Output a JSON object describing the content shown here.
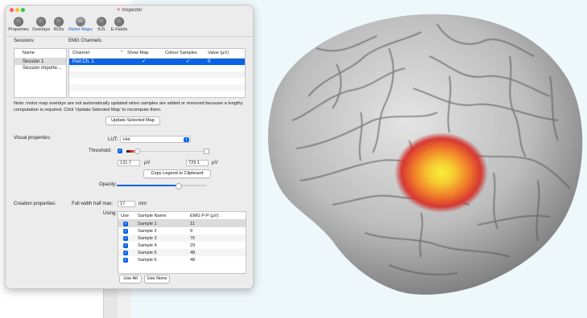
{
  "window": {
    "title": "Inspector"
  },
  "toolbar": {
    "items": [
      {
        "label": "Properties",
        "icon": "properties-icon"
      },
      {
        "label": "Overlays",
        "icon": "overlays-icon"
      },
      {
        "label": "ROIs",
        "icon": "rois-icon"
      },
      {
        "label": "Motor Maps",
        "icon": "motor-maps-icon"
      },
      {
        "label": "fUS",
        "icon": "fus-icon"
      },
      {
        "label": "E-Fields",
        "icon": "e-fields-icon"
      }
    ],
    "active": "Motor Maps"
  },
  "sessions": {
    "label": "Sessions:",
    "column": "Name",
    "items": [
      "Session 1",
      "Session importe..."
    ]
  },
  "emg": {
    "label": "EMG Channels:",
    "columns": [
      "Channel",
      "Show Map",
      "Colour Samples",
      "Value (µV)"
    ],
    "rows": [
      {
        "channel": "Pod Ch. 1",
        "show_map": true,
        "colour_samples": true,
        "value": "0"
      }
    ]
  },
  "note": "Note: motor map overlays are not automatically updated when samples are added or removed because a lengthy computation is required. Click 'Update Selected Map' to recompute them.",
  "update_button": "Update Selected Map",
  "visual": {
    "label": "Visual properties:",
    "lut_label": "LUT:",
    "lut_value": "Hot",
    "threshold_label": "Threshold:",
    "threshold_enabled": true,
    "min_value": "131.7",
    "min_unit": "µV",
    "max_value": "729.1",
    "max_unit": "µV",
    "copy_legend_button": "Copy Legend to Clipboard",
    "opacity_label": "Opacity:",
    "opacity": 0.68
  },
  "creation": {
    "label": "Creation properties:",
    "fwhm_label": "Full width half max:",
    "fwhm_value": "17",
    "fwhm_unit": "mm",
    "using_label": "Using:",
    "columns": [
      "Use",
      "Sample Name",
      "EMG P-P (µV)"
    ],
    "samples": [
      {
        "name": "Sample 1",
        "value": "11",
        "use": true
      },
      {
        "name": "Sample 2",
        "value": "9",
        "use": true
      },
      {
        "name": "Sample 3",
        "value": "76",
        "use": true
      },
      {
        "name": "Sample 4",
        "value": "29",
        "use": true
      },
      {
        "name": "Sample 5",
        "value": "48",
        "use": true
      },
      {
        "name": "Sample 6",
        "value": "48",
        "use": true
      }
    ],
    "use_all_button": "Use All",
    "use_none_button": "Use None"
  },
  "colors": {
    "accent": "#0a63e6",
    "heat_outer": "#d8312a",
    "heat_inner": "#f7e23a",
    "viewport_bg": "#eef8fb"
  }
}
